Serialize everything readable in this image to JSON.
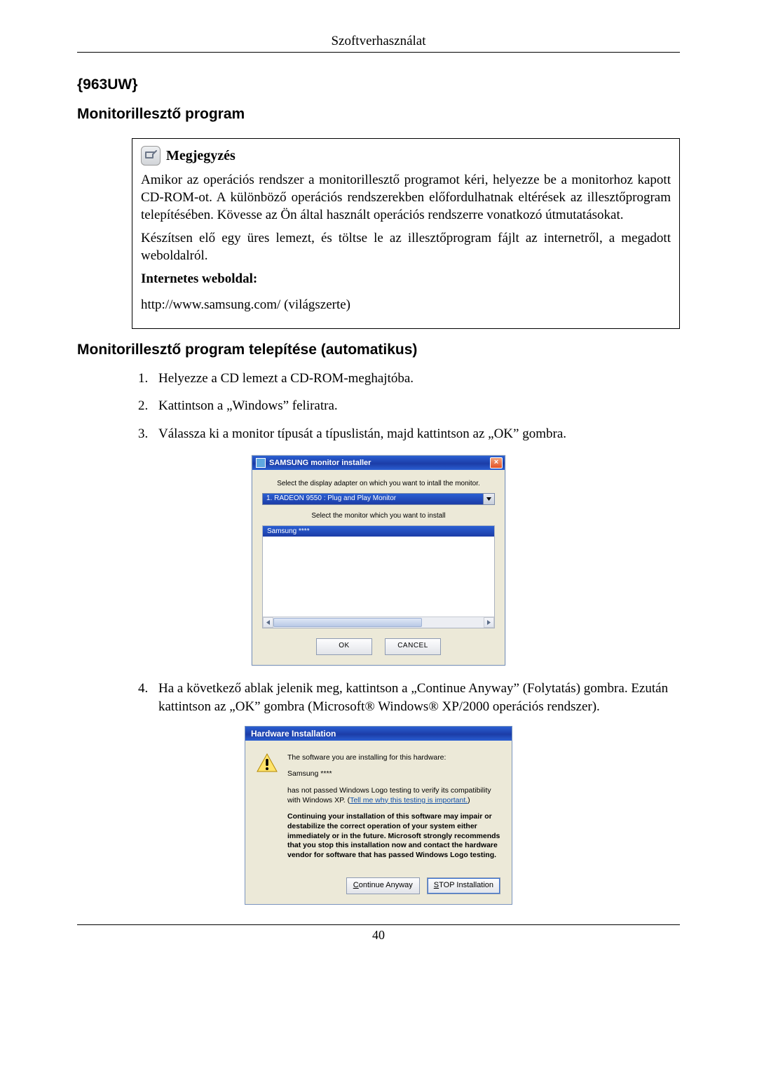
{
  "header": {
    "title": "Szoftverhasználat"
  },
  "headings": {
    "model": "{963UW}",
    "driver_program": "Monitorillesztő program",
    "install_auto": "Monitorillesztő program telepítése (automatikus)"
  },
  "note": {
    "title": "Megjegyzés",
    "paragraph1": "Amikor az operációs rendszer a monitorillesztő programot kéri, helyezze be a monitorhoz kapott CD-ROM-ot. A különböző operációs rendszerekben előfordulhatnak eltérések az illesztőprogram telepítésében. Kövesse az Ön által használt operációs rendszerre vonatkozó útmutatásokat.",
    "paragraph2": "Készítsen elő egy üres lemezt, és töltse le az illesztőprogram fájlt az internetről, a megadott weboldalról.",
    "website_label": "Internetes weboldal:",
    "website_value": "http://www.samsung.com/ (világszerte)"
  },
  "steps": [
    "Helyezze a CD lemezt a CD-ROM-meghajtóba.",
    "Kattintson a „Windows” feliratra.",
    "Válassza ki a monitor típusát a típuslistán, majd kattintson az „OK” gombra.",
    "Ha a következő ablak jelenik meg, kattintson a „Continue Anyway” (Folytatás) gombra. Ezután kattintson az „OK” gombra (Microsoft® Windows® XP/2000 operációs rendszer)."
  ],
  "installer": {
    "title": "SAMSUNG monitor installer",
    "prompt1": "Select the display adapter on which you want to intall the monitor.",
    "adapter_selected": "1. RADEON 9550 : Plug and Play Monitor",
    "prompt2": "Select the monitor which you want to install",
    "monitor_selected": "Samsung ****",
    "ok": "OK",
    "cancel": "CANCEL"
  },
  "hardware_dialog": {
    "title": "Hardware Installation",
    "line1": "The software you are installing for this hardware:",
    "device": "Samsung ****",
    "line2a": "has not passed Windows Logo testing to verify its compatibility with Windows XP. (",
    "link": "Tell me why this testing is important.",
    "line2b": ")",
    "warning_bold": "Continuing your installation of this software may impair or destabilize the correct operation of your system either immediately or in the future. Microsoft strongly recommends that you stop this installation now and contact the hardware vendor for software that has passed Windows Logo testing.",
    "btn_continue": "Continue Anyway",
    "btn_stop": "STOP Installation"
  },
  "page_number": "40"
}
